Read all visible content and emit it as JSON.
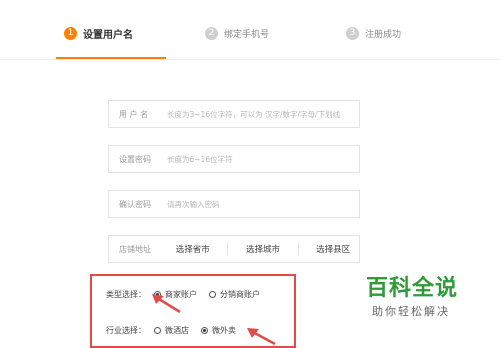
{
  "steps": [
    {
      "num": "1",
      "label": "设置用户名"
    },
    {
      "num": "2",
      "label": "绑定手机号"
    },
    {
      "num": "3",
      "label": "注册成功"
    }
  ],
  "form": {
    "username": {
      "label": "用 户 名",
      "placeholder": "长度为3~16位字符，可以为 汉字/数字/字母/下划线"
    },
    "password": {
      "label": "设置密码",
      "placeholder": "长度为6~16位字符"
    },
    "confirm": {
      "label": "确认密码",
      "placeholder": "请再次输入密码"
    },
    "address": {
      "label": "店铺地址",
      "province": "选择省市",
      "city": "选择城市",
      "county": "选择县区"
    }
  },
  "type_select": {
    "label": "类型选择：",
    "options": [
      {
        "text": "商家账户",
        "checked": true
      },
      {
        "text": "分销商账户",
        "checked": false
      }
    ]
  },
  "industry_select": {
    "label": "行业选择：",
    "options": [
      {
        "text": "微酒店",
        "checked": false
      },
      {
        "text": "微外卖",
        "checked": true
      }
    ]
  },
  "watermark": {
    "title": "百科全说",
    "subtitle": "助你轻松解决"
  },
  "colors": {
    "accent": "#ff7f00",
    "annotation_red": "#e34a4a",
    "watermark_green": "#2d9b36"
  },
  "icons": [
    "step-number-icon",
    "radio-icon",
    "annotation-arrow-icon"
  ]
}
